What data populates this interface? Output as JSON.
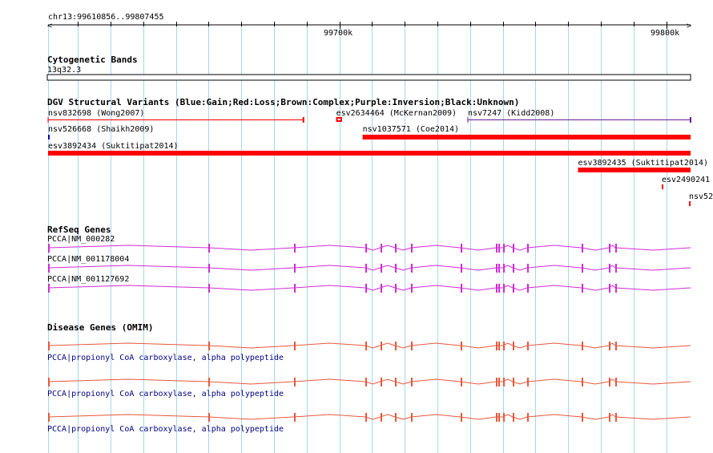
{
  "ruler": {
    "region_label": "chr13:99610856..99807455",
    "start": 99610856,
    "end": 99807455,
    "tick_labels": [
      "99700k",
      "99800k"
    ]
  },
  "cytoband": {
    "title": "Cytogenetic Bands",
    "band": "13q32.3"
  },
  "dgv": {
    "title": "DGV Structural Variants (Blue:Gain;Red:Loss;Brown:Complex;Purple:Inversion;Black:Unknown)",
    "variants": [
      {
        "id": "nsv832698",
        "label": "nsv832698 (Wong2007)",
        "start": 99610856,
        "end": 99689000,
        "type": "Loss",
        "style": "thin"
      },
      {
        "id": "esv2634464",
        "label": "esv2634464 (McKernan2009)",
        "start": 99699000,
        "end": 99700800,
        "type": "Loss",
        "style": "tick"
      },
      {
        "id": "nsv7247",
        "label": "nsv7247 (Kidd2008)",
        "start": 99739300,
        "end": 99807455,
        "type": "Inversion",
        "style": "thin"
      },
      {
        "id": "nsv526668",
        "label": "nsv526668 (Shaikh2009)",
        "start": 99610856,
        "end": 99611300,
        "type": "Gain",
        "style": "mark"
      },
      {
        "id": "nsv1037571",
        "label": "nsv1037571 (Coe2014)",
        "start": 99707100,
        "end": 99807455,
        "type": "Loss",
        "style": "thick"
      },
      {
        "id": "esv3892434",
        "label": "esv3892434 (Suktitipat2014)",
        "start": 99610856,
        "end": 99807455,
        "type": "Loss",
        "style": "thick"
      },
      {
        "id": "esv3892435",
        "label": "esv3892435 (Suktitipat2014)",
        "start": 99773000,
        "end": 99807455,
        "type": "Loss",
        "style": "thick"
      },
      {
        "id": "esv2490241",
        "label": "esv2490241",
        "start": 99798900,
        "end": 99799400,
        "type": "Loss",
        "style": "mark"
      },
      {
        "id": "nsv52",
        "label": "nsv52",
        "start": 99806800,
        "end": 99807300,
        "type": "Loss",
        "style": "mark"
      }
    ]
  },
  "refseq": {
    "title": "RefSeq Genes",
    "genes": [
      {
        "label": "PCCA|NM_000282"
      },
      {
        "label": "PCCA|NM_001178004"
      },
      {
        "label": "PCCA|NM_001127692"
      }
    ]
  },
  "omim": {
    "title": "Disease Genes (OMIM)",
    "genes": [
      {
        "label": "PCCA|propionyl CoA carboxylase, alpha polypeptide"
      },
      {
        "label": "PCCA|propionyl CoA carboxylase, alpha polypeptide"
      },
      {
        "label": "PCCA|propionyl CoA carboxylase, alpha polypeptide"
      }
    ]
  },
  "exons": [
    99610856,
    99660000,
    99686000,
    99708000,
    99712500,
    99717000,
    99722000,
    99737000,
    99748000,
    99748700,
    99750000,
    99753000,
    99757500,
    99774000,
    99782500,
    99784500
  ],
  "colors": {
    "gain": "#0000c8",
    "loss": "#ff0000",
    "inversion": "#6a1b9a",
    "refseq": "#d12bd8",
    "omim": "#e8583b",
    "grid": "#a5d6ef",
    "ruler": "#000000",
    "omim_text": "#000080"
  }
}
